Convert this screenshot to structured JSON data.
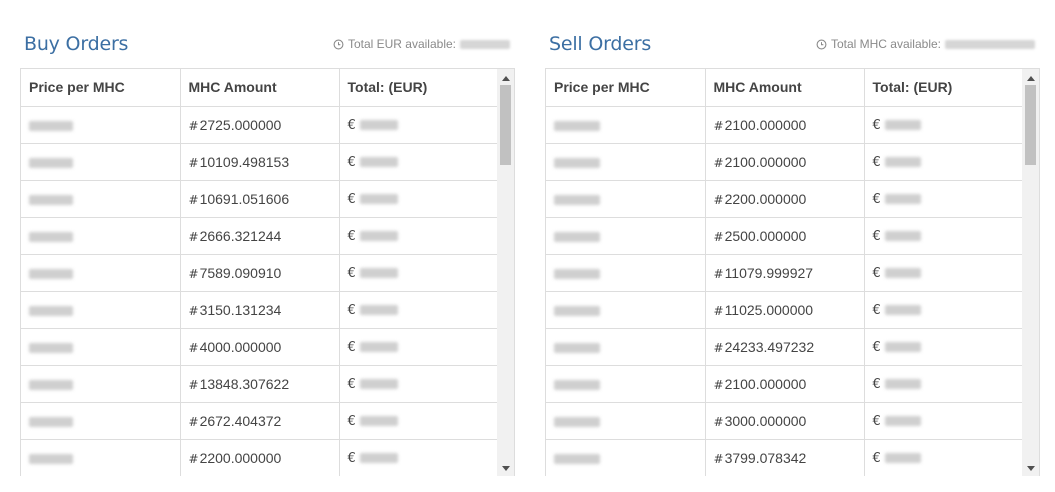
{
  "buy": {
    "title": "Buy Orders",
    "available_label": "Total EUR available:",
    "columns": [
      "Price per MHC",
      "MHC Amount",
      "Total: (EUR)"
    ],
    "rows": [
      {
        "amount": "2725.000000"
      },
      {
        "amount": "10109.498153"
      },
      {
        "amount": "10691.051606"
      },
      {
        "amount": "2666.321244"
      },
      {
        "amount": "7589.090910"
      },
      {
        "amount": "3150.131234"
      },
      {
        "amount": "4000.000000"
      },
      {
        "amount": "13848.307622"
      },
      {
        "amount": "2672.404372"
      },
      {
        "amount": "2200.000000"
      }
    ]
  },
  "sell": {
    "title": "Sell Orders",
    "available_label": "Total MHC available:",
    "columns": [
      "Price per MHC",
      "MHC Amount",
      "Total: (EUR)"
    ],
    "rows": [
      {
        "amount": "2100.000000"
      },
      {
        "amount": "2100.000000"
      },
      {
        "amount": "2200.000000"
      },
      {
        "amount": "2500.000000"
      },
      {
        "amount": "11079.999927"
      },
      {
        "amount": "11025.000000"
      },
      {
        "amount": "24233.497232"
      },
      {
        "amount": "2100.000000"
      },
      {
        "amount": "3000.000000"
      },
      {
        "amount": "3799.078342"
      }
    ]
  },
  "symbols": {
    "hash": "#",
    "euro": "€"
  },
  "icons": {
    "clock": "clock-icon",
    "scroll_up": "scroll-up-arrow-icon",
    "scroll_down": "scroll-down-arrow-icon"
  },
  "colors": {
    "title": "#3c6fa3",
    "border": "#dddddd",
    "muted": "#8a8a8a"
  }
}
